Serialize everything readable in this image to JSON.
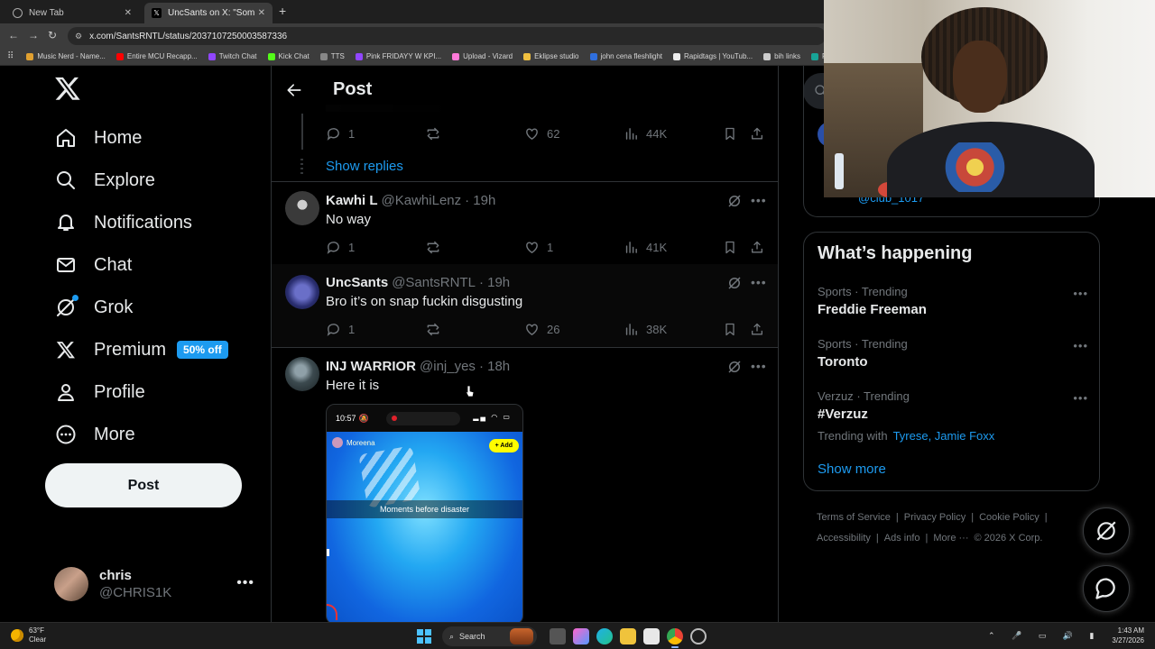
{
  "browser": {
    "tabs": [
      {
        "title": "New Tab",
        "active": false
      },
      {
        "title": "UncSants on X: \"Someone ",
        "active": true
      }
    ],
    "url": "x.com/SantsRNTL/status/2037107250003587336",
    "bookmarks": [
      {
        "label": "Music Nerd - Name...",
        "color": "#e0a030"
      },
      {
        "label": "Entire MCU Recapp...",
        "color": "#ff0000"
      },
      {
        "label": "Twitch Chat",
        "color": "#9146ff"
      },
      {
        "label": "Kick Chat",
        "color": "#53fc18"
      },
      {
        "label": "TTS",
        "color": "#888888"
      },
      {
        "label": "Pink FRIDAYY W KPI...",
        "color": "#9146ff"
      },
      {
        "label": "Upload - Vizard",
        "color": "#ff7ad9"
      },
      {
        "label": "Eklipse studio",
        "color": "#f0c040"
      },
      {
        "label": "john cena fleshlight",
        "color": "#2f6fde"
      },
      {
        "label": "Rapidtags | YouTub...",
        "color": "#eeeeee"
      },
      {
        "label": "bih links",
        "color": "#cccccc"
      },
      {
        "label": "Photopea",
        "color": "#18a497"
      }
    ]
  },
  "nav": {
    "items": [
      {
        "label": "Home",
        "icon": "home-icon"
      },
      {
        "label": "Explore",
        "icon": "search-icon"
      },
      {
        "label": "Notifications",
        "icon": "bell-icon"
      },
      {
        "label": "Chat",
        "icon": "mail-icon"
      },
      {
        "label": "Grok",
        "icon": "grok-icon"
      },
      {
        "label": "Premium",
        "icon": "x-icon"
      },
      {
        "label": "Profile",
        "icon": "person-icon"
      },
      {
        "label": "More",
        "icon": "more-circle-icon"
      }
    ],
    "premium_badge": "50% off",
    "post_button": "Post"
  },
  "account": {
    "name": "chris",
    "handle": "@CHRIS1K"
  },
  "main": {
    "title": "Post",
    "show_replies": "Show replies",
    "top_actions": {
      "replies": "1",
      "likes": "62",
      "views": "44K"
    },
    "replies": [
      {
        "name": "Kawhi L",
        "handle": "@KawhiLenz",
        "time": "· 19h",
        "text": "No way",
        "replies": "1",
        "reposts": "",
        "likes": "1",
        "views": "41K"
      },
      {
        "name": "UncSants",
        "handle": "@SantsRNTL",
        "time": "· 19h",
        "text": "Bro it’s on snap fuckin disgusting",
        "replies": "1",
        "reposts": "",
        "likes": "26",
        "views": "38K"
      },
      {
        "name": "INJ WARRIOR",
        "handle": "@inj_yes",
        "time": "· 18h",
        "text": "Here it is"
      }
    ],
    "media": {
      "phone_time": "10:57",
      "snap_user": "Moreena",
      "add_label": "+ Add",
      "caption": "Moments before disaster"
    }
  },
  "right": {
    "prev_handle": "@club_1017",
    "trends_title": "What’s happening",
    "trends": [
      {
        "meta": "Sports · Trending",
        "name": "Freddie Freeman"
      },
      {
        "meta": "Sports · Trending",
        "name": "Toronto"
      },
      {
        "meta": "Verzuz · Trending",
        "name": "#Verzuz",
        "with_label": "Trending with",
        "with_links": "Tyrese, Jamie Foxx"
      }
    ],
    "show_more": "Show more",
    "footer": {
      "tos": "Terms of Service",
      "privacy": "Privacy Policy",
      "cookie": "Cookie Policy",
      "accessibility": "Accessibility",
      "ads": "Ads info",
      "more": "More ···",
      "copyright": "© 2026 X Corp."
    }
  },
  "taskbar": {
    "temp": "63°F",
    "condition": "Clear",
    "search": "Search",
    "time": "1:43 AM",
    "date": "3/27/2026"
  },
  "colors": {
    "accent": "#1d9bf0",
    "background": "#000000",
    "border": "#2f3336",
    "muted": "#71767b"
  }
}
